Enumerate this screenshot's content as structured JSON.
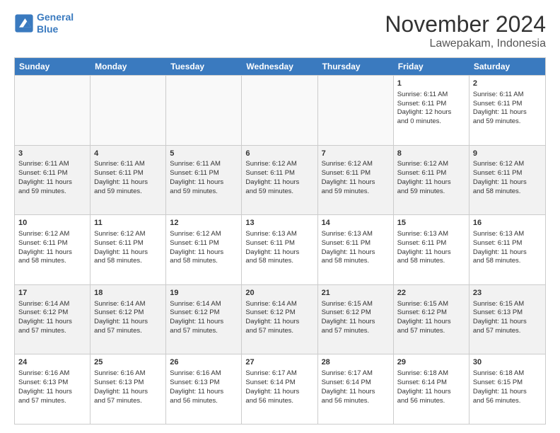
{
  "logo": {
    "line1": "General",
    "line2": "Blue"
  },
  "title": "November 2024",
  "subtitle": "Lawepakam, Indonesia",
  "days_of_week": [
    "Sunday",
    "Monday",
    "Tuesday",
    "Wednesday",
    "Thursday",
    "Friday",
    "Saturday"
  ],
  "weeks": [
    [
      {
        "day": "",
        "empty": true
      },
      {
        "day": "",
        "empty": true
      },
      {
        "day": "",
        "empty": true
      },
      {
        "day": "",
        "empty": true
      },
      {
        "day": "",
        "empty": true
      },
      {
        "day": "1",
        "lines": [
          "Sunrise: 6:11 AM",
          "Sunset: 6:11 PM",
          "Daylight: 12 hours",
          "and 0 minutes."
        ]
      },
      {
        "day": "2",
        "lines": [
          "Sunrise: 6:11 AM",
          "Sunset: 6:11 PM",
          "Daylight: 11 hours",
          "and 59 minutes."
        ]
      }
    ],
    [
      {
        "day": "3",
        "lines": [
          "Sunrise: 6:11 AM",
          "Sunset: 6:11 PM",
          "Daylight: 11 hours",
          "and 59 minutes."
        ]
      },
      {
        "day": "4",
        "lines": [
          "Sunrise: 6:11 AM",
          "Sunset: 6:11 PM",
          "Daylight: 11 hours",
          "and 59 minutes."
        ]
      },
      {
        "day": "5",
        "lines": [
          "Sunrise: 6:11 AM",
          "Sunset: 6:11 PM",
          "Daylight: 11 hours",
          "and 59 minutes."
        ]
      },
      {
        "day": "6",
        "lines": [
          "Sunrise: 6:12 AM",
          "Sunset: 6:11 PM",
          "Daylight: 11 hours",
          "and 59 minutes."
        ]
      },
      {
        "day": "7",
        "lines": [
          "Sunrise: 6:12 AM",
          "Sunset: 6:11 PM",
          "Daylight: 11 hours",
          "and 59 minutes."
        ]
      },
      {
        "day": "8",
        "lines": [
          "Sunrise: 6:12 AM",
          "Sunset: 6:11 PM",
          "Daylight: 11 hours",
          "and 59 minutes."
        ]
      },
      {
        "day": "9",
        "lines": [
          "Sunrise: 6:12 AM",
          "Sunset: 6:11 PM",
          "Daylight: 11 hours",
          "and 58 minutes."
        ]
      }
    ],
    [
      {
        "day": "10",
        "lines": [
          "Sunrise: 6:12 AM",
          "Sunset: 6:11 PM",
          "Daylight: 11 hours",
          "and 58 minutes."
        ]
      },
      {
        "day": "11",
        "lines": [
          "Sunrise: 6:12 AM",
          "Sunset: 6:11 PM",
          "Daylight: 11 hours",
          "and 58 minutes."
        ]
      },
      {
        "day": "12",
        "lines": [
          "Sunrise: 6:12 AM",
          "Sunset: 6:11 PM",
          "Daylight: 11 hours",
          "and 58 minutes."
        ]
      },
      {
        "day": "13",
        "lines": [
          "Sunrise: 6:13 AM",
          "Sunset: 6:11 PM",
          "Daylight: 11 hours",
          "and 58 minutes."
        ]
      },
      {
        "day": "14",
        "lines": [
          "Sunrise: 6:13 AM",
          "Sunset: 6:11 PM",
          "Daylight: 11 hours",
          "and 58 minutes."
        ]
      },
      {
        "day": "15",
        "lines": [
          "Sunrise: 6:13 AM",
          "Sunset: 6:11 PM",
          "Daylight: 11 hours",
          "and 58 minutes."
        ]
      },
      {
        "day": "16",
        "lines": [
          "Sunrise: 6:13 AM",
          "Sunset: 6:11 PM",
          "Daylight: 11 hours",
          "and 58 minutes."
        ]
      }
    ],
    [
      {
        "day": "17",
        "lines": [
          "Sunrise: 6:14 AM",
          "Sunset: 6:12 PM",
          "Daylight: 11 hours",
          "and 57 minutes."
        ]
      },
      {
        "day": "18",
        "lines": [
          "Sunrise: 6:14 AM",
          "Sunset: 6:12 PM",
          "Daylight: 11 hours",
          "and 57 minutes."
        ]
      },
      {
        "day": "19",
        "lines": [
          "Sunrise: 6:14 AM",
          "Sunset: 6:12 PM",
          "Daylight: 11 hours",
          "and 57 minutes."
        ]
      },
      {
        "day": "20",
        "lines": [
          "Sunrise: 6:14 AM",
          "Sunset: 6:12 PM",
          "Daylight: 11 hours",
          "and 57 minutes."
        ]
      },
      {
        "day": "21",
        "lines": [
          "Sunrise: 6:15 AM",
          "Sunset: 6:12 PM",
          "Daylight: 11 hours",
          "and 57 minutes."
        ]
      },
      {
        "day": "22",
        "lines": [
          "Sunrise: 6:15 AM",
          "Sunset: 6:12 PM",
          "Daylight: 11 hours",
          "and 57 minutes."
        ]
      },
      {
        "day": "23",
        "lines": [
          "Sunrise: 6:15 AM",
          "Sunset: 6:13 PM",
          "Daylight: 11 hours",
          "and 57 minutes."
        ]
      }
    ],
    [
      {
        "day": "24",
        "lines": [
          "Sunrise: 6:16 AM",
          "Sunset: 6:13 PM",
          "Daylight: 11 hours",
          "and 57 minutes."
        ]
      },
      {
        "day": "25",
        "lines": [
          "Sunrise: 6:16 AM",
          "Sunset: 6:13 PM",
          "Daylight: 11 hours",
          "and 57 minutes."
        ]
      },
      {
        "day": "26",
        "lines": [
          "Sunrise: 6:16 AM",
          "Sunset: 6:13 PM",
          "Daylight: 11 hours",
          "and 56 minutes."
        ]
      },
      {
        "day": "27",
        "lines": [
          "Sunrise: 6:17 AM",
          "Sunset: 6:14 PM",
          "Daylight: 11 hours",
          "and 56 minutes."
        ]
      },
      {
        "day": "28",
        "lines": [
          "Sunrise: 6:17 AM",
          "Sunset: 6:14 PM",
          "Daylight: 11 hours",
          "and 56 minutes."
        ]
      },
      {
        "day": "29",
        "lines": [
          "Sunrise: 6:18 AM",
          "Sunset: 6:14 PM",
          "Daylight: 11 hours",
          "and 56 minutes."
        ]
      },
      {
        "day": "30",
        "lines": [
          "Sunrise: 6:18 AM",
          "Sunset: 6:15 PM",
          "Daylight: 11 hours",
          "and 56 minutes."
        ]
      }
    ]
  ]
}
